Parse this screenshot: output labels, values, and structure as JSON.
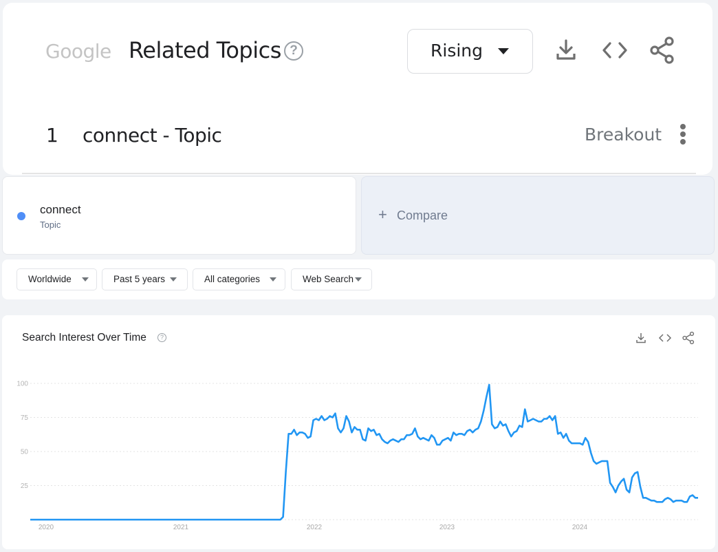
{
  "header": {
    "logo": "Google",
    "title": "Related Topics",
    "help_icon": "help-circle-icon",
    "sort_select": {
      "selected": "Rising"
    },
    "actions": [
      "download-icon",
      "embed-code-icon",
      "share-icon"
    ]
  },
  "related_topics": [
    {
      "rank": "1",
      "label": "connect - Topic",
      "value": "Breakout",
      "menu_icon": "more-vert-icon"
    }
  ],
  "terms": [
    {
      "name": "connect",
      "type": "Topic",
      "color": "#4f8ef7"
    }
  ],
  "compare": {
    "label": "Compare",
    "icon": "plus-icon"
  },
  "filters": [
    {
      "label": "Worldwide"
    },
    {
      "label": "Past 5 years"
    },
    {
      "label": "All categories"
    },
    {
      "label": "Web Search"
    }
  ],
  "chart_card": {
    "title": "Search Interest Over Time",
    "actions": [
      "download-icon",
      "embed-code-icon",
      "share-icon"
    ]
  },
  "chart_data": {
    "type": "line",
    "title": "Search Interest Over Time",
    "xlabel": "",
    "ylabel": "",
    "ylim": [
      0,
      100
    ],
    "yticks": [
      "25",
      "50",
      "75",
      "100"
    ],
    "ytick_values": [
      25,
      50,
      75,
      100
    ],
    "xticks": [
      "2020",
      "2021",
      "2022",
      "2023",
      "2024"
    ],
    "grid": true,
    "legend": "none",
    "series": [
      {
        "name": "connect",
        "color": "#2196f3",
        "frequency": "weekly",
        "start_zero_weeks": 91,
        "values": [
          0,
          2,
          35,
          63,
          63,
          66,
          62,
          64,
          64,
          63,
          60,
          61,
          73,
          74,
          73,
          76,
          73,
          74,
          76,
          75,
          78,
          67,
          64,
          67,
          76,
          72,
          64,
          68,
          66,
          66,
          59,
          58,
          67,
          65,
          66,
          62,
          63,
          59,
          57,
          56,
          58,
          59,
          58,
          57,
          59,
          59,
          62,
          62,
          63,
          67,
          61,
          59,
          60,
          59,
          58,
          62,
          60,
          55,
          55,
          58,
          59,
          60,
          58,
          64,
          62,
          63,
          63,
          62,
          65,
          66,
          64,
          66,
          67,
          72,
          80,
          90,
          99,
          70,
          67,
          68,
          72,
          69,
          70,
          65,
          61,
          64,
          65,
          69,
          68,
          81,
          72,
          73,
          74,
          73,
          72,
          72,
          74,
          74,
          76,
          73,
          76,
          63,
          64,
          60,
          63,
          58,
          56,
          56,
          56,
          56,
          55,
          60,
          57,
          49,
          43,
          41,
          42,
          43,
          43,
          43,
          27,
          24,
          20,
          25,
          28,
          30,
          22,
          20,
          31,
          34,
          35,
          24,
          16,
          16,
          15,
          14,
          14,
          13,
          13,
          13,
          15,
          16,
          15,
          13,
          14,
          14,
          14,
          13,
          13,
          17,
          18,
          16,
          16
        ]
      }
    ]
  }
}
